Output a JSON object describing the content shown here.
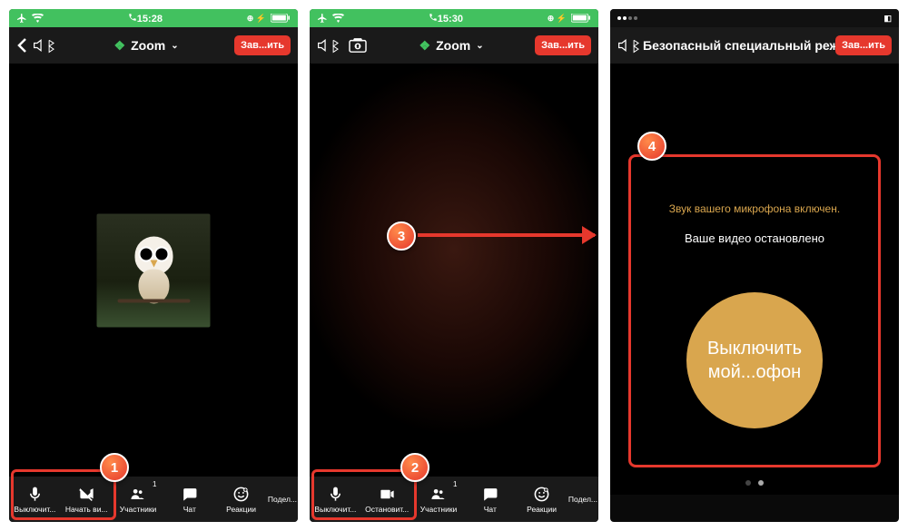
{
  "status1": {
    "time": "15:28"
  },
  "status2": {
    "time": "15:30"
  },
  "nav": {
    "title": "Zoom",
    "end": "Зав...ить"
  },
  "nav3": {
    "title": "Безопасный специальный реж"
  },
  "tb": {
    "mute": "Выключит...",
    "startVid": "Начать ви...",
    "stopVid": "Остановит...",
    "part": "Участники",
    "chat": "Чат",
    "react": "Реакции",
    "share": "Подел...",
    "partCount": "1"
  },
  "safe": {
    "mic": "Звук вашего микрофона включен.",
    "vid": "Ваше видео остановлено",
    "btn1": "Выключить",
    "btn2": "мой...офон"
  },
  "markers": {
    "m1": "1",
    "m2": "2",
    "m3": "3",
    "m4": "4"
  }
}
